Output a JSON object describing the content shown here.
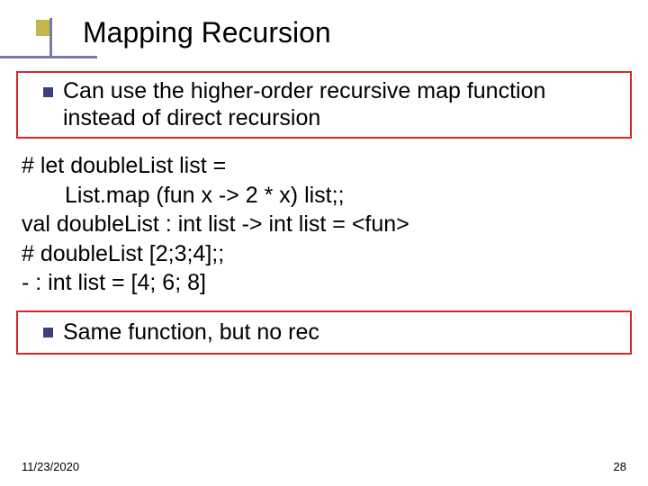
{
  "slide": {
    "title": "Mapping Recursion",
    "bullet1": "Can use the higher-order recursive map function instead of direct recursion",
    "code": {
      "l1": "# let doubleList list =",
      "l2": "List.map (fun x -> 2 * x) list;;",
      "l3": "val doubleList : int list -> int list = <fun>",
      "l4": "# doubleList [2;3;4];;",
      "l5": "- : int list = [4; 6; 8]"
    },
    "bullet2": "Same function, but no rec",
    "footer": {
      "date": "11/23/2020",
      "page": "28"
    }
  }
}
